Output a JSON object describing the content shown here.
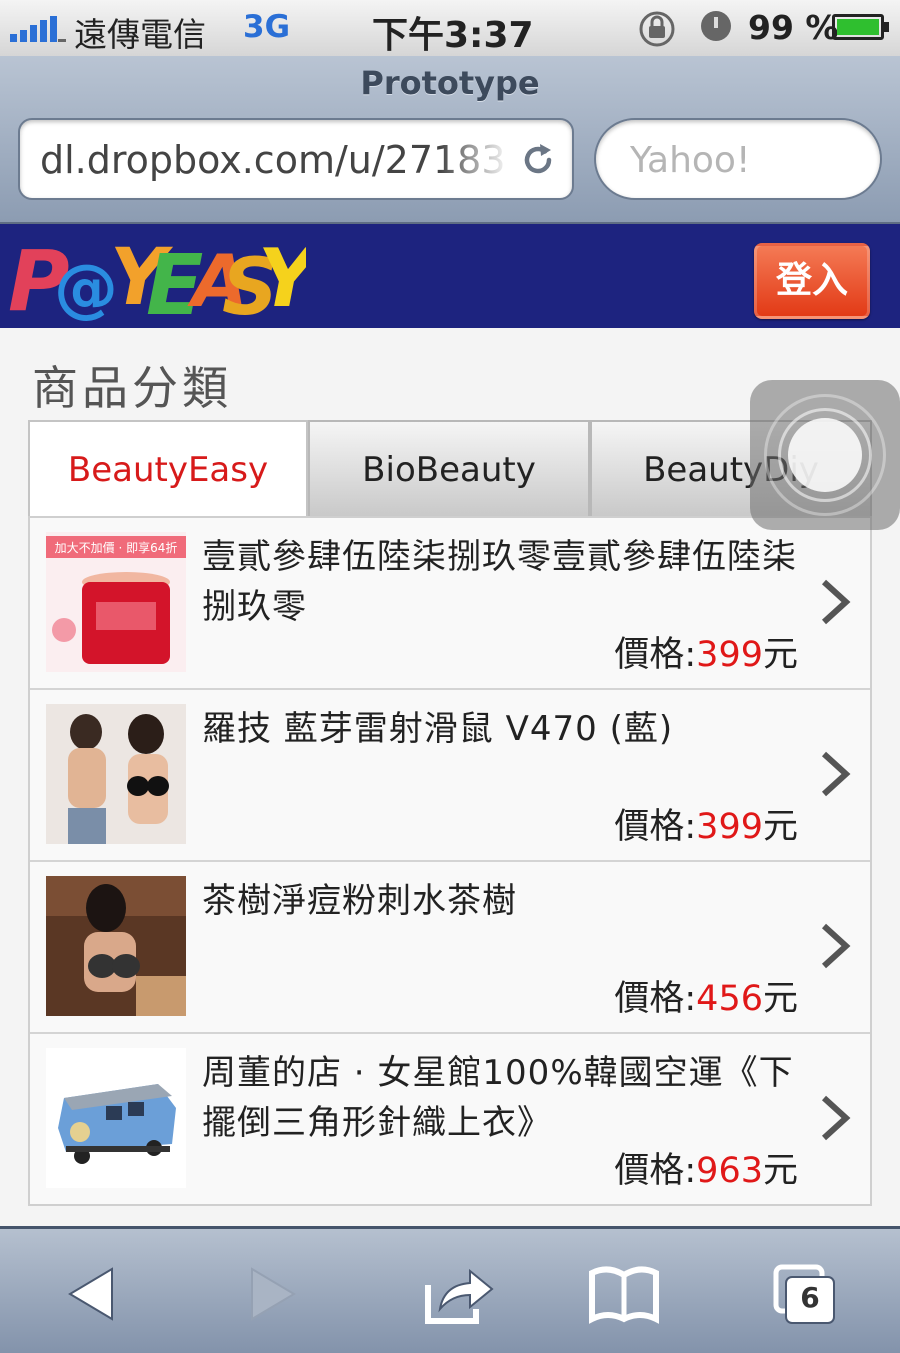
{
  "status_bar": {
    "carrier": "遠傳電信",
    "network": "3G",
    "time": "下午3:37",
    "battery_percent": "99 %",
    "icons": [
      "signal-icon",
      "rotation-lock-icon",
      "alarm-icon",
      "battery-charging-icon"
    ]
  },
  "browser": {
    "page_title": "Prototype",
    "url": "dl.dropbox.com/u/27183",
    "search_placeholder": "Yahoo!",
    "tab_count": "6"
  },
  "site": {
    "logo_text": "P@YEASY",
    "login_label": "登入",
    "colors": {
      "header_bg": "#1d237f",
      "login_bg": "#e23a16",
      "price": "#e01818",
      "active_tab": "#d71a1a"
    }
  },
  "category": {
    "title": "商品分類",
    "tabs": [
      {
        "label": "BeautyEasy",
        "active": true
      },
      {
        "label": "BioBeauty",
        "active": false
      },
      {
        "label": "BeautyDiy",
        "active": false
      }
    ]
  },
  "products": [
    {
      "name": "壹貳參肆伍陸柒捌玖零壹貳參肆伍陸柒捌玖零",
      "price_label": "價格:",
      "price": "399",
      "unit": "元",
      "thumb_text": "加大不加價 · 即享64折"
    },
    {
      "name": "羅技 藍芽雷射滑鼠 V470 (藍)",
      "price_label": "價格:",
      "price": "399",
      "unit": "元",
      "thumb_text": ""
    },
    {
      "name": "茶樹淨痘粉刺水茶樹",
      "price_label": "價格:",
      "price": "456",
      "unit": "元",
      "thumb_text": ""
    },
    {
      "name": "周董的店 · 女星館100%韓國空運《下擺倒三角形針織上衣》",
      "price_label": "價格:",
      "price": "963",
      "unit": "元",
      "thumb_text": ""
    }
  ]
}
